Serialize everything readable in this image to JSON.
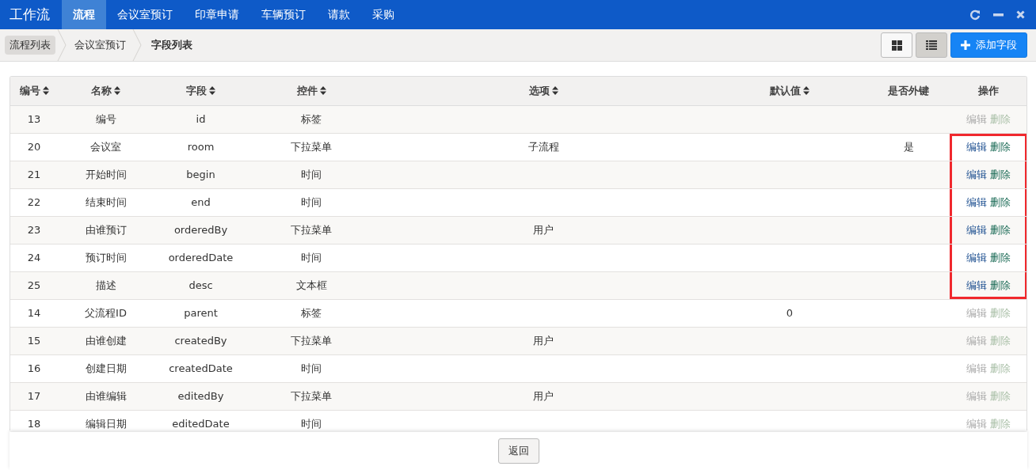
{
  "app_title": "工作流",
  "nav_tabs": [
    {
      "label": "流程",
      "selected": true
    },
    {
      "label": "会议室预订",
      "selected": false
    },
    {
      "label": "印章申请",
      "selected": false
    },
    {
      "label": "车辆预订",
      "selected": false
    },
    {
      "label": "请款",
      "selected": false
    },
    {
      "label": "采购",
      "selected": false
    }
  ],
  "breadcrumb": [
    {
      "label": "流程列表",
      "current": false
    },
    {
      "label": "会议室预订",
      "current": false
    },
    {
      "label": "字段列表",
      "current": true
    }
  ],
  "view_buttons": [
    {
      "kind": "grid",
      "selected": false
    },
    {
      "kind": "list",
      "selected": true
    }
  ],
  "add_button": "添加字段",
  "table": {
    "columns": [
      {
        "label": "编号",
        "sortable": true
      },
      {
        "label": "名称",
        "sortable": true
      },
      {
        "label": "字段",
        "sortable": true
      },
      {
        "label": "控件",
        "sortable": true
      },
      {
        "label": "选项",
        "sortable": true
      },
      {
        "label": "默认值",
        "sortable": true
      },
      {
        "label": "是否外键",
        "sortable": false
      },
      {
        "label": "操作",
        "sortable": false
      }
    ],
    "rows": [
      {
        "cells": [
          "13",
          "编号",
          "id",
          "标签",
          "",
          "",
          "",
          ""
        ],
        "edit": "编辑",
        "delete": "删除",
        "disabled": true,
        "highlighted": false
      },
      {
        "cells": [
          "20",
          "会议室",
          "room",
          "下拉菜单",
          "子流程",
          "",
          "是"
        ],
        "edit": "编辑",
        "delete": "删除",
        "disabled": false,
        "highlighted": true
      },
      {
        "cells": [
          "21",
          "开始时间",
          "begin",
          "时间",
          "",
          "",
          ""
        ],
        "edit": "编辑",
        "delete": "删除",
        "disabled": false,
        "highlighted": true
      },
      {
        "cells": [
          "22",
          "结束时间",
          "end",
          "时间",
          "",
          "",
          ""
        ],
        "edit": "编辑",
        "delete": "删除",
        "disabled": false,
        "highlighted": true
      },
      {
        "cells": [
          "23",
          "由谁预订",
          "orderedBy",
          "下拉菜单",
          "用户",
          "",
          ""
        ],
        "edit": "编辑",
        "delete": "删除",
        "disabled": false,
        "highlighted": true
      },
      {
        "cells": [
          "24",
          "预订时间",
          "orderedDate",
          "时间",
          "",
          "",
          ""
        ],
        "edit": "编辑",
        "delete": "删除",
        "disabled": false,
        "highlighted": true
      },
      {
        "cells": [
          "25",
          "描述",
          "desc",
          "文本框",
          "",
          "",
          ""
        ],
        "edit": "编辑",
        "delete": "删除",
        "disabled": false,
        "highlighted": true
      },
      {
        "cells": [
          "14",
          "父流程ID",
          "parent",
          "标签",
          "",
          "0",
          ""
        ],
        "edit": "编辑",
        "delete": "删除",
        "disabled": true,
        "highlighted": false
      },
      {
        "cells": [
          "15",
          "由谁创建",
          "createdBy",
          "下拉菜单",
          "用户",
          "",
          ""
        ],
        "edit": "编辑",
        "delete": "删除",
        "disabled": true,
        "highlighted": false
      },
      {
        "cells": [
          "16",
          "创建日期",
          "createdDate",
          "时间",
          "",
          "",
          ""
        ],
        "edit": "编辑",
        "delete": "删除",
        "disabled": true,
        "highlighted": false
      },
      {
        "cells": [
          "17",
          "由谁编辑",
          "editedBy",
          "下拉菜单",
          "用户",
          "",
          ""
        ],
        "edit": "编辑",
        "delete": "删除",
        "disabled": true,
        "highlighted": false
      },
      {
        "cells": [
          "18",
          "编辑日期",
          "editedDate",
          "时间",
          "",
          "",
          ""
        ],
        "edit": "编辑",
        "delete": "删除",
        "disabled": true,
        "highlighted": false
      }
    ]
  },
  "back_button": "返回"
}
